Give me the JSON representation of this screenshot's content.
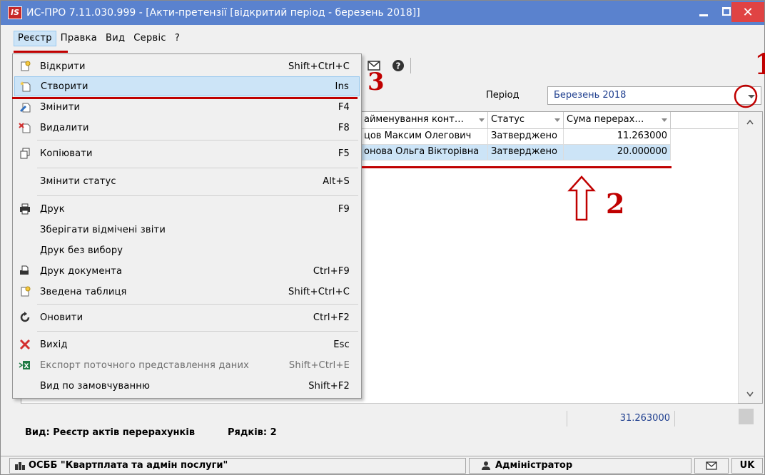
{
  "window": {
    "title": "ИС-ПРО 7.11.030.999 - [Акти-претензії [відкритий період - березень 2018]]",
    "logo_text": "IS"
  },
  "menubar": [
    {
      "label": "Реєстр",
      "active": true
    },
    {
      "label": "Правка"
    },
    {
      "label": "Вид"
    },
    {
      "label": "Сервіс"
    },
    {
      "label": "?"
    }
  ],
  "dropdown": {
    "items": [
      {
        "label": "Відкрити",
        "shortcut": "Shift+Ctrl+C",
        "icon": "open-doc-icon"
      },
      {
        "label": "Створити",
        "shortcut": "Ins",
        "icon": "new-doc-icon",
        "highlighted": true
      },
      {
        "label": "Змінити",
        "shortcut": "F4",
        "icon": "edit-doc-icon"
      },
      {
        "label": "Видалити",
        "shortcut": "F8",
        "icon": "delete-doc-icon"
      },
      {
        "label": "Копіювати",
        "shortcut": "F5",
        "icon": "copy-icon"
      },
      {
        "label": "Змінити статус",
        "shortcut": "Alt+S",
        "icon": ""
      },
      {
        "label": "Друк",
        "shortcut": "F9",
        "icon": "printer-icon"
      },
      {
        "label": "Зберігати відмічені звіти",
        "shortcut": "",
        "icon": ""
      },
      {
        "label": "Друк без вибору",
        "shortcut": "",
        "icon": ""
      },
      {
        "label": "Друк документа",
        "shortcut": "Ctrl+F9",
        "icon": "print-doc-icon"
      },
      {
        "label": "Зведена таблиця",
        "shortcut": "Shift+Ctrl+C",
        "icon": "pivot-table-icon"
      },
      {
        "label": "Оновити",
        "shortcut": "Ctrl+F2",
        "icon": "refresh-icon"
      },
      {
        "label": "Вихід",
        "shortcut": "Esc",
        "icon": "exit-icon"
      },
      {
        "label": "Експорт поточного представлення даних",
        "shortcut": "Shift+Ctrl+E",
        "icon": "excel-export-icon",
        "disabled": true
      },
      {
        "label": "Вид по замовчуванню",
        "shortcut": "Shift+F2",
        "icon": ""
      }
    ]
  },
  "period": {
    "label": "Період",
    "value": "Березень 2018"
  },
  "grid": {
    "columns": [
      "айменування конт…",
      "Статус",
      "Сума перерах…"
    ],
    "rows": [
      {
        "name": "цов Максим Олегович",
        "status": "Затверджено",
        "sum": "11.263000"
      },
      {
        "name": "онова Ольга Вікторівна",
        "status": "Затверджено",
        "sum": "20.000000",
        "selected": true
      }
    ],
    "total": "31.263000"
  },
  "footer": {
    "view": "Вид: Реєстр актів перерахунків",
    "rows": "Рядків: 2"
  },
  "statusbar": {
    "org": "ОСББ \"Квартплата та адмін послуги\"",
    "user": "Адміністратор",
    "lang": "UK"
  },
  "annotations": {
    "n1": "1",
    "n2": "2",
    "n3": "3"
  },
  "colors": {
    "titlebar": "#5a82ce",
    "selection": "#cce4f7",
    "annotation": "#c00000",
    "link_blue": "#1f3f8f"
  }
}
